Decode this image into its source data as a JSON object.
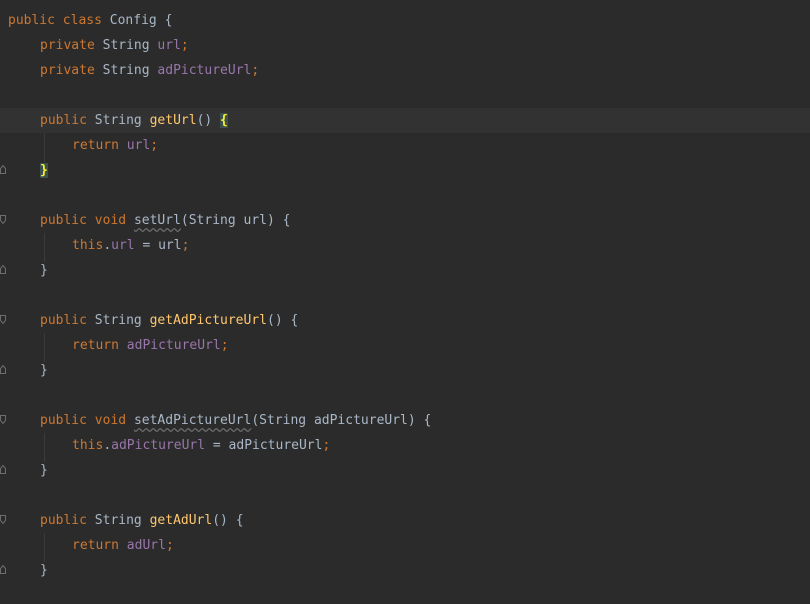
{
  "editor": {
    "colors": {
      "background": "#2b2b2b",
      "current_line": "#323232",
      "keyword": "#cc7832",
      "field": "#9876aa",
      "method": "#ffc66d",
      "plain": "#a9b7c6",
      "brace_match": "#ffef28"
    },
    "code": {
      "l1": {
        "kw1": "public",
        "kw2": "class",
        "name": "Config",
        "brace": "{"
      },
      "l2": {
        "kw": "private",
        "type": "String",
        "field": "url",
        "semi": ";"
      },
      "l3": {
        "kw": "private",
        "type": "String",
        "field": "adPictureUrl",
        "semi": ";"
      },
      "l5": {
        "kw": "public",
        "type": "String",
        "method": "getUrl",
        "parens": "()",
        "brace": "{"
      },
      "l6": {
        "kw": "return",
        "field": "url",
        "semi": ";"
      },
      "l7": {
        "brace": "}"
      },
      "l9": {
        "kw1": "public",
        "kw2": "void",
        "method": "setUrl",
        "params": "(String url)",
        "brace": "{"
      },
      "l10": {
        "kw": "this",
        "dot": ".",
        "field": "url",
        "rest": " = url",
        "semi": ";"
      },
      "l11": {
        "brace": "}"
      },
      "l13": {
        "kw": "public",
        "type": "String",
        "method": "getAdPictureUrl",
        "parens": "()",
        "brace": "{"
      },
      "l14": {
        "kw": "return",
        "field": "adPictureUrl",
        "semi": ";"
      },
      "l15": {
        "brace": "}"
      },
      "l17": {
        "kw1": "public",
        "kw2": "void",
        "method": "setAdPictureUrl",
        "params": "(String adPictureUrl)",
        "brace": "{"
      },
      "l18": {
        "kw": "this",
        "dot": ".",
        "field": "adPictureUrl",
        "rest": " = adPictureUrl",
        "semi": ";"
      },
      "l19": {
        "brace": "}"
      },
      "l21": {
        "kw": "public",
        "type": "String",
        "method": "getAdUrl",
        "parens": "()",
        "brace": "{"
      },
      "l22": {
        "kw": "return",
        "field": "adUrl",
        "semi": ";"
      },
      "l23": {
        "brace": "}"
      }
    }
  }
}
